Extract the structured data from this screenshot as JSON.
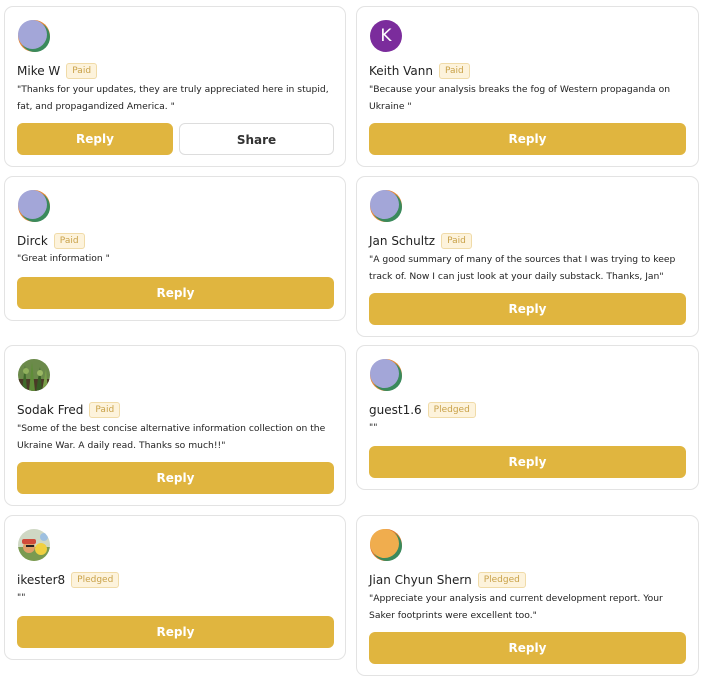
{
  "colors": {
    "accent": "#e0b53f",
    "badge_text": "#c9a24a"
  },
  "cards": [
    {
      "name": "Mike W",
      "badge": "Paid",
      "quote": "\"Thanks for your updates, they are truly appreciated here in stupid, fat, and propagandized America. \"",
      "reply_label": "Reply",
      "share_label": "Share",
      "avatar": "default-avatar-icon"
    },
    {
      "name": "Keith Vann",
      "badge": "Paid",
      "quote": "\"Because your analysis breaks the fog of Western propaganda on Ukraine \"",
      "reply_label": "Reply",
      "avatar_letter": "K",
      "avatar": "letter-avatar"
    },
    {
      "name": "Dirck",
      "badge": "Paid",
      "quote": "\"Great information \"",
      "reply_label": "Reply",
      "avatar": "default-avatar-icon"
    },
    {
      "name": "Jan Schultz",
      "badge": "Paid",
      "quote": "\"A good summary of many of the sources that I was trying to keep track of. Now I can just look at your daily substack. Thanks, Jan\"",
      "reply_label": "Reply",
      "avatar": "default-avatar-icon"
    },
    {
      "name": "Sodak Fred",
      "badge": "Paid",
      "quote": "\"Some of the best concise alternative information collection on the Ukraine War. A daily read. Thanks so much!!\"",
      "reply_label": "Reply",
      "avatar": "photo-avatar-plants"
    },
    {
      "name": "guest1.6",
      "badge": "Pledged",
      "quote": "\"\"",
      "reply_label": "Reply",
      "avatar": "default-avatar-icon"
    },
    {
      "name": "ikester8",
      "badge": "Pledged",
      "quote": "\"\"",
      "reply_label": "Reply",
      "avatar": "photo-avatar-person"
    },
    {
      "name": "Jian Chyun Shern",
      "badge": "Pledged",
      "quote": "\"Appreciate your analysis and current development report. Your Saker footprints were excellent too.\"",
      "reply_label": "Reply",
      "avatar": "default-avatar-orange-icon"
    }
  ]
}
